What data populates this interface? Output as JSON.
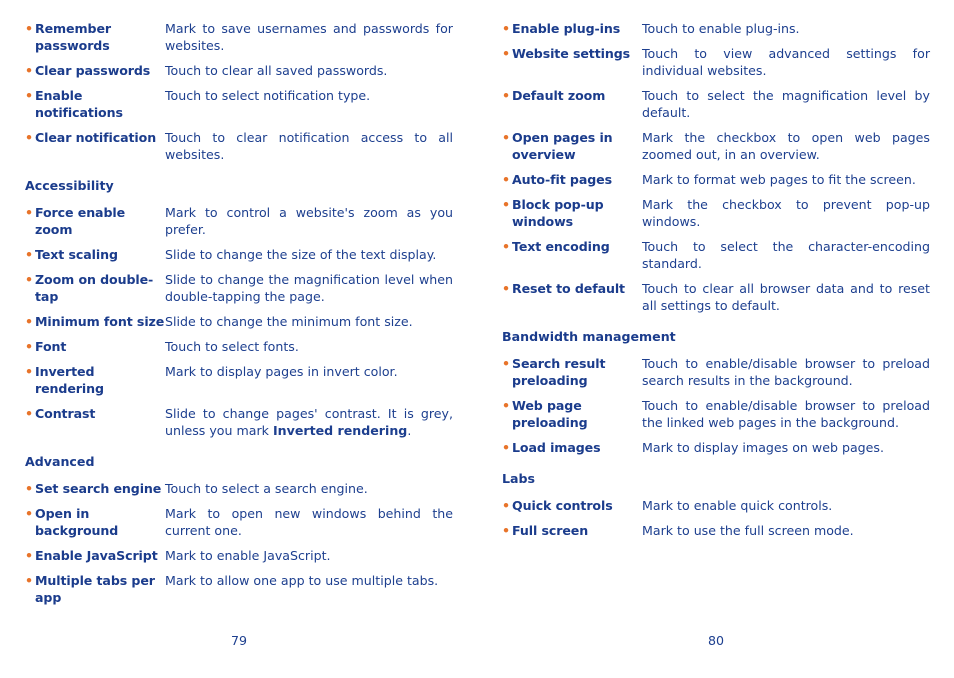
{
  "left_page": {
    "page_number": "79",
    "groups": [
      {
        "heading": "",
        "items": [
          {
            "term": "Remember passwords",
            "desc": "Mark to save usernames and passwords for websites."
          },
          {
            "term": "Clear passwords",
            "desc": "Touch to clear all saved passwords."
          },
          {
            "term": "Enable notifications",
            "desc": "Touch to select notification type."
          },
          {
            "term": "Clear notification",
            "desc": "Touch to clear notification access to all websites."
          }
        ]
      },
      {
        "heading": "Accessibility",
        "items": [
          {
            "term": "Force enable zoom",
            "desc": "Mark to control a website's zoom as you prefer."
          },
          {
            "term": "Text scaling",
            "desc": "Slide to change the size of the text display."
          },
          {
            "term": "Zoom on double-tap",
            "desc": "Slide to change the magnification level when double-tapping the page."
          },
          {
            "term": "Minimum font size",
            "desc": "Slide to change the minimum font size."
          },
          {
            "term": "Font",
            "desc": "Touch to select fonts."
          },
          {
            "term": "Inverted rendering",
            "desc": "Mark to display pages in invert color."
          },
          {
            "term": "Contrast",
            "desc": "Slide to change pages' contrast. It is grey, unless you mark ",
            "desc_bold": "Inverted rendering",
            "desc_tail": "."
          }
        ]
      },
      {
        "heading": "Advanced",
        "items": [
          {
            "term": "Set search engine",
            "desc": "Touch to select a search engine."
          },
          {
            "term": "Open in background",
            "desc": "Mark to open new windows behind the current one."
          },
          {
            "term": "Enable JavaScript",
            "desc": "Mark to enable JavaScript."
          },
          {
            "term": "Multiple tabs per app",
            "desc": "Mark to allow one app to use multiple tabs."
          }
        ]
      }
    ]
  },
  "right_page": {
    "page_number": "80",
    "groups": [
      {
        "heading": "",
        "items": [
          {
            "term": "Enable plug-ins",
            "desc": "Touch to enable plug-ins."
          },
          {
            "term": "Website settings",
            "desc": "Touch to view advanced settings for individual websites."
          },
          {
            "term": "Default zoom",
            "desc": "Touch to select the magnification level by default."
          },
          {
            "term": "Open pages in overview",
            "desc": "Mark the checkbox to open web pages zoomed out, in an overview."
          },
          {
            "term": "Auto-fit pages",
            "desc": "Mark to format web pages to fit the screen."
          },
          {
            "term": "Block pop-up windows",
            "desc": "Mark the checkbox to prevent pop-up windows."
          },
          {
            "term": "Text encoding",
            "desc": "Touch to select the character-encoding standard."
          },
          {
            "term": "Reset to default",
            "desc": "Touch to clear all browser data and to reset all settings to default."
          }
        ]
      },
      {
        "heading": "Bandwidth management",
        "items": [
          {
            "term": "Search result preloading",
            "desc": "Touch to enable/disable browser to preload search results in the background."
          },
          {
            "term": "Web page preloading",
            "desc": "Touch to enable/disable browser to preload the linked web pages in the background."
          },
          {
            "term": "Load images",
            "desc": "Mark to display images on web pages."
          }
        ]
      },
      {
        "heading": "Labs",
        "items": [
          {
            "term": "Quick controls",
            "desc": "Mark to enable quick controls."
          },
          {
            "term": "Full screen",
            "desc": "Mark to use the full screen mode."
          }
        ]
      }
    ]
  }
}
